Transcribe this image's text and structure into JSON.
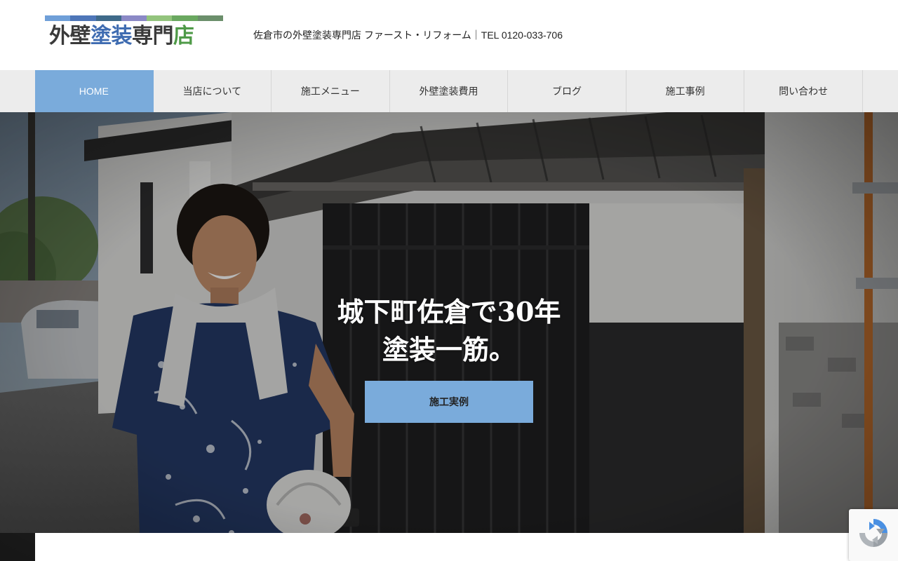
{
  "header": {
    "logo": {
      "text_parts": [
        "外壁",
        "塗装",
        "専門",
        "店"
      ],
      "bar_colors": [
        "#6f9fd8",
        "#4e76b8",
        "#3f6a8a",
        "#8b89c6",
        "#93c47d",
        "#6aa860",
        "#6b8f6b"
      ],
      "text_colors": [
        "#3a3a3a",
        "#3f6cb1",
        "#3a3a3a",
        "#4f9a48"
      ]
    },
    "tagline": "佐倉市の外壁塗装専門店 ファースト・リフォーム｜TEL 0120-033-706"
  },
  "nav": {
    "items": [
      {
        "label": "HOME",
        "active": true
      },
      {
        "label": "当店について",
        "active": false
      },
      {
        "label": "施工メニュー",
        "active": false
      },
      {
        "label": "外壁塗装費用",
        "active": false
      },
      {
        "label": "ブログ",
        "active": false
      },
      {
        "label": "施工事例",
        "active": false
      },
      {
        "label": "問い合わせ",
        "active": false
      }
    ],
    "active_color": "#7aabdb"
  },
  "hero": {
    "headline_line1": "城下町佐倉で30年",
    "headline_line2": "塗装一筋。",
    "button_label": "施工実例",
    "button_color": "#7aabdb"
  },
  "recaptcha": {
    "icon": "recaptcha-icon"
  }
}
